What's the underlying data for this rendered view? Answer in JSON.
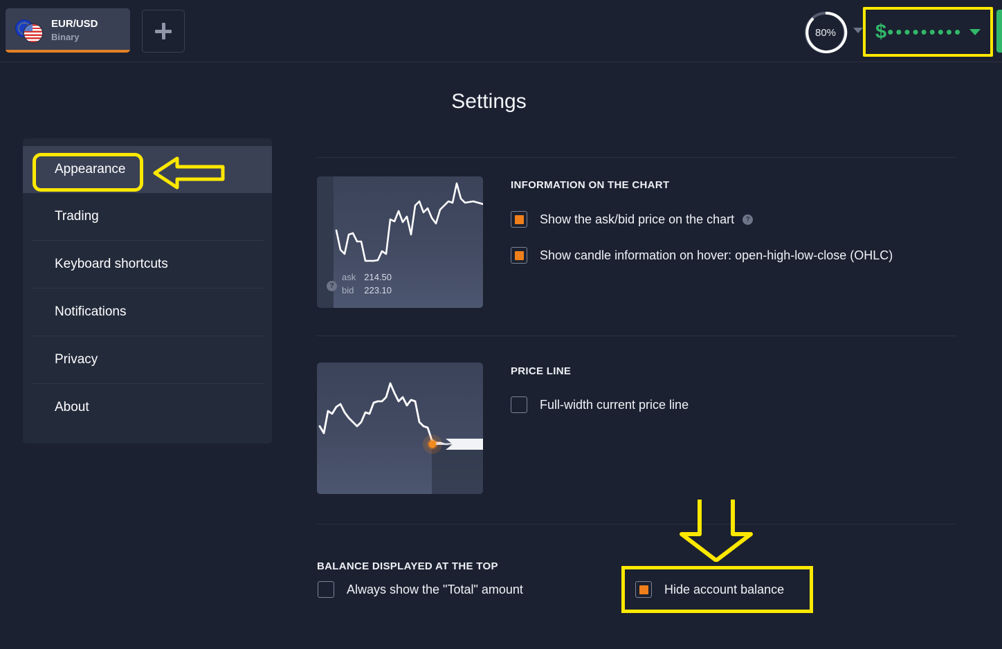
{
  "topbar": {
    "asset": {
      "name": "EUR/USD",
      "type": "Binary",
      "icon_left": "eu-flag-icon",
      "icon_right": "us-flag-icon"
    },
    "add_tab_label": "+",
    "payout": {
      "value": "80%",
      "percent": 80
    },
    "balance": {
      "currency_symbol": "$",
      "masked_value": "•••••••••",
      "hidden": true
    },
    "accent_green": "#32b86a",
    "accent_orange": "#e38026"
  },
  "page": {
    "title": "Settings"
  },
  "sidebar": {
    "items": [
      {
        "label": "Appearance",
        "active": true
      },
      {
        "label": "Trading",
        "active": false
      },
      {
        "label": "Keyboard shortcuts",
        "active": false
      },
      {
        "label": "Notifications",
        "active": false
      },
      {
        "label": "Privacy",
        "active": false
      },
      {
        "label": "About",
        "active": false
      }
    ]
  },
  "sections": {
    "information_on_the_chart": {
      "title": "INFORMATION ON THE CHART",
      "preview": {
        "ask_label": "ask",
        "ask_value": "214.50",
        "bid_label": "bid",
        "bid_value": "223.10",
        "help": "?"
      },
      "options": [
        {
          "label": "Show the ask/bid price on the chart",
          "checked": true,
          "has_help": true,
          "help": "?"
        },
        {
          "label": "Show candle information on hover: open-high-low-close (OHLC)",
          "checked": true,
          "has_help": false
        }
      ]
    },
    "price_line": {
      "title": "PRICE LINE",
      "options": [
        {
          "label": "Full-width current price line",
          "checked": false
        }
      ]
    },
    "balance_displayed_at_the_top": {
      "title": "BALANCE DISPLAYED AT THE TOP",
      "options": [
        {
          "label": "Always show the \"Total\" amount",
          "checked": false
        },
        {
          "label": "Hide account balance",
          "checked": true
        }
      ]
    }
  },
  "annotations": {
    "color": "#ffe800",
    "items": [
      {
        "kind": "rounded-rect",
        "target": "sidebar-item-appearance"
      },
      {
        "kind": "arrow-left",
        "target": "sidebar-item-appearance"
      },
      {
        "kind": "rect",
        "target": "balance-display"
      },
      {
        "kind": "rect",
        "target": "hide-account-balance-option"
      },
      {
        "kind": "arrow-down",
        "target": "hide-account-balance-option"
      }
    ]
  }
}
